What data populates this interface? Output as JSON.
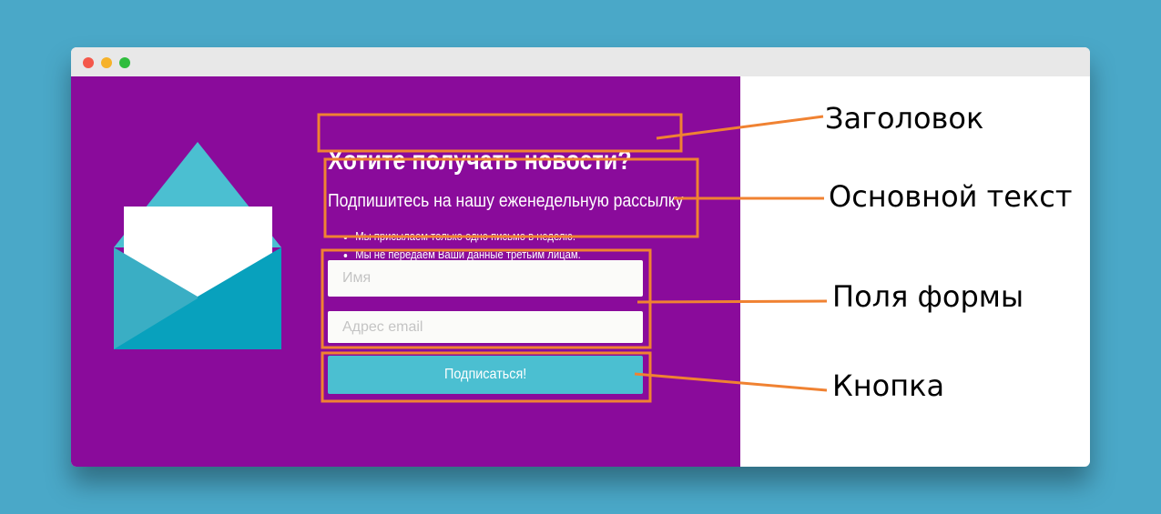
{
  "window": {
    "controls": [
      "close",
      "minimize",
      "maximize"
    ],
    "control_colors": {
      "close": "#f4584b",
      "minimize": "#f6b22a",
      "maximize": "#2fbd3d"
    }
  },
  "form": {
    "background_color": "#8a0b9b",
    "accent_color": "#4bbfd1",
    "headline": "Хотите получать новости?",
    "subhead": "Подпишитесь на нашу еженедельную рассылку",
    "bullets": [
      "Мы присылаем только одно письмо в неделю.",
      "Мы не передаем Ваши данные третьим лицам."
    ],
    "name_placeholder": "Имя",
    "email_placeholder": "Адрес email",
    "name_value": "",
    "email_value": "",
    "button_label": "Подписаться!"
  },
  "annotations": {
    "color": "#f08232",
    "labels": [
      "Заголовок",
      "Основной текст",
      "Поля формы",
      "Кнопка"
    ]
  }
}
